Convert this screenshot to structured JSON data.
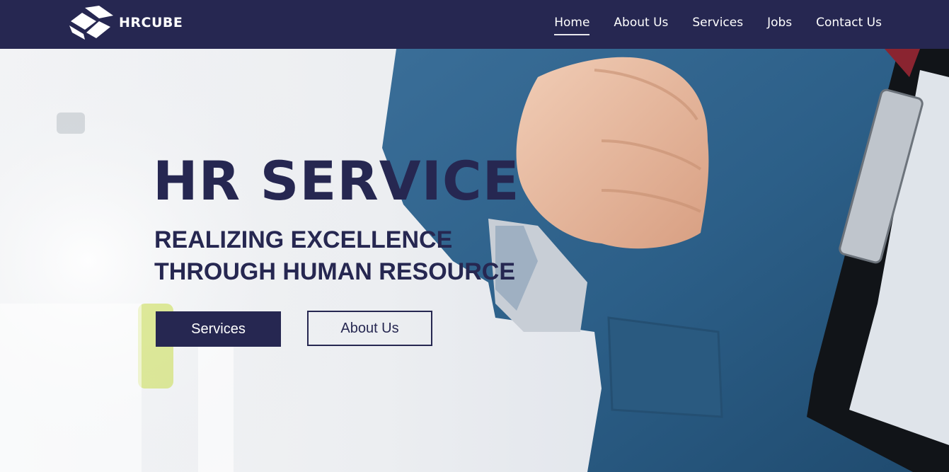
{
  "brand": {
    "name": "HRCUBE"
  },
  "nav": {
    "items": [
      {
        "label": "Home",
        "active": true
      },
      {
        "label": "About Us",
        "active": false
      },
      {
        "label": "Services",
        "active": false
      },
      {
        "label": "Jobs",
        "active": false
      },
      {
        "label": "Contact Us",
        "active": false
      }
    ]
  },
  "hero": {
    "title": "HR SERVICE",
    "subtitle_line1": "REALIZING EXCELLENCE",
    "subtitle_line2": "THROUGH HUMAN RESOURCE",
    "primary_button": "Services",
    "secondary_button": "About Us"
  },
  "colors": {
    "brand_navy": "#262751",
    "suit_blue": "#2c5f88",
    "white": "#ffffff"
  }
}
